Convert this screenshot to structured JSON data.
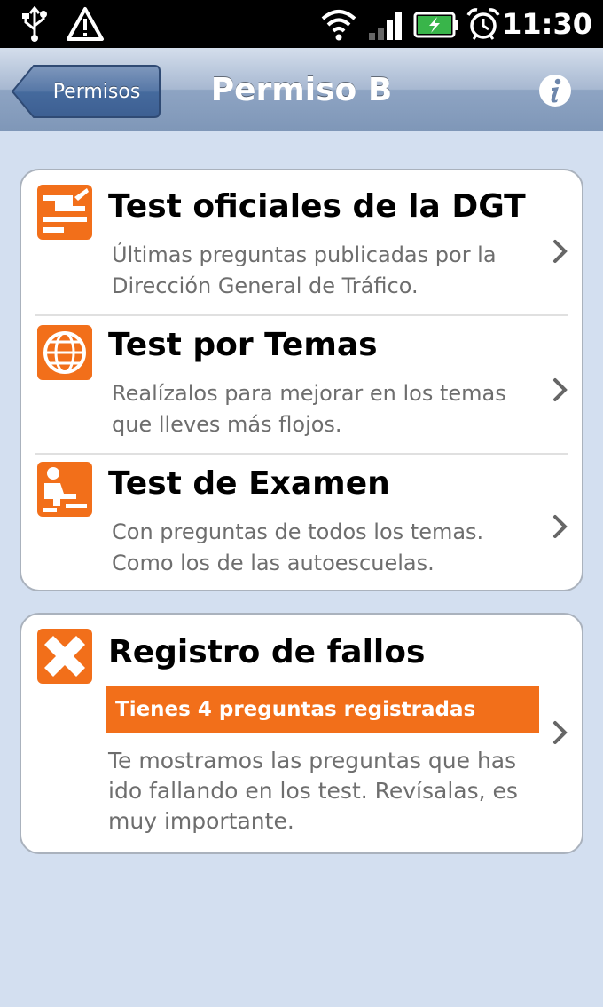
{
  "status_bar": {
    "time": "11:30",
    "left_icons": [
      "usb-icon",
      "warning-icon"
    ],
    "right_icons": [
      "wifi-icon",
      "signal-icon",
      "battery-charging-icon",
      "alarm-icon"
    ]
  },
  "nav": {
    "back_label": "Permisos",
    "title": "Permiso B",
    "info_icon": "info-icon"
  },
  "menu": {
    "items": [
      {
        "title": "Test oficiales de la DGT",
        "description": "Últimas preguntas publicadas por la Dirección General de Tráfico.",
        "icon": "official-test-icon"
      },
      {
        "title": "Test por Temas",
        "description": "Realízalos para mejorar en los temas que lleves más flojos.",
        "icon": "globe-icon"
      },
      {
        "title": "Test de Examen",
        "description": "Con preguntas de todos los temas. Como los de las autoescuelas.",
        "icon": "exam-student-icon"
      }
    ]
  },
  "errors": {
    "title": "Registro de fallos",
    "badge": "Tienes 4 preguntas registradas",
    "description": "Te mostramos las preguntas que has ido fallando en los test. Revísalas, es muy importante.",
    "icon": "cross-icon"
  },
  "colors": {
    "accent": "#f26f1a",
    "background": "#d3dff0",
    "nav_bar": "#8ea4c3"
  }
}
